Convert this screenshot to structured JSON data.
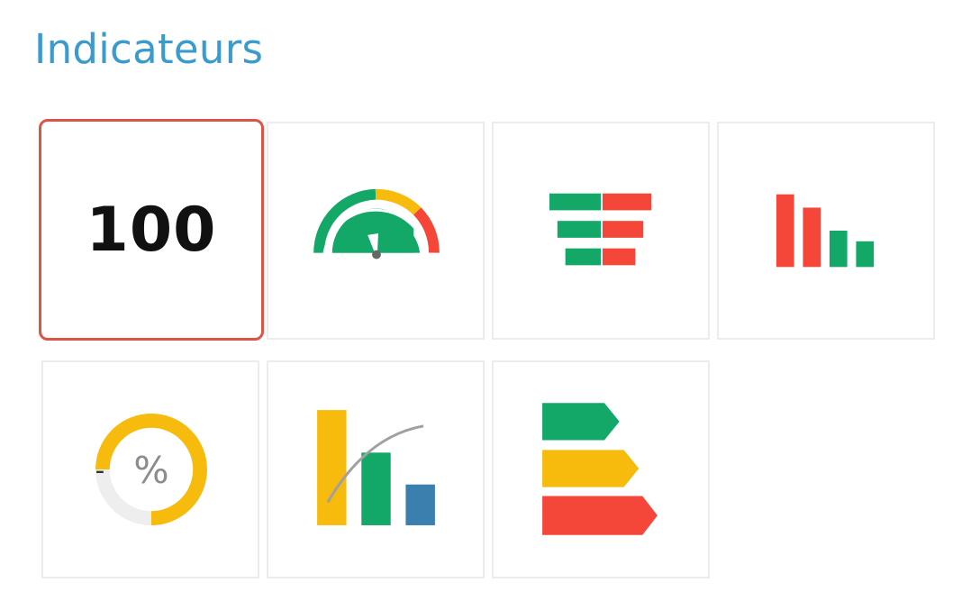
{
  "section": {
    "title": "Indicateurs"
  },
  "tiles": [
    {
      "name": "number",
      "label": "100",
      "icon": "number-value-icon",
      "selected": true
    },
    {
      "name": "gauge",
      "icon": "gauge-icon",
      "selected": false
    },
    {
      "name": "diverging-bars",
      "icon": "diverging-bars-icon",
      "selected": false
    },
    {
      "name": "ranked-bars",
      "icon": "ranked-bars-icon",
      "selected": false
    },
    {
      "name": "donut-percent",
      "label": "%",
      "dash": "-",
      "icon": "donut-percent-icon",
      "selected": false
    },
    {
      "name": "pareto",
      "icon": "pareto-chart-icon",
      "selected": false
    },
    {
      "name": "energy-label",
      "icon": "energy-rating-icon",
      "selected": false
    }
  ],
  "colors": {
    "title": "#3a9bcc",
    "selected_border": "#db5444",
    "green": "#13a867",
    "red": "#f4473a",
    "yellow": "#f6bb0c",
    "blue": "#3a7fae",
    "grey": "#eeeeee"
  }
}
